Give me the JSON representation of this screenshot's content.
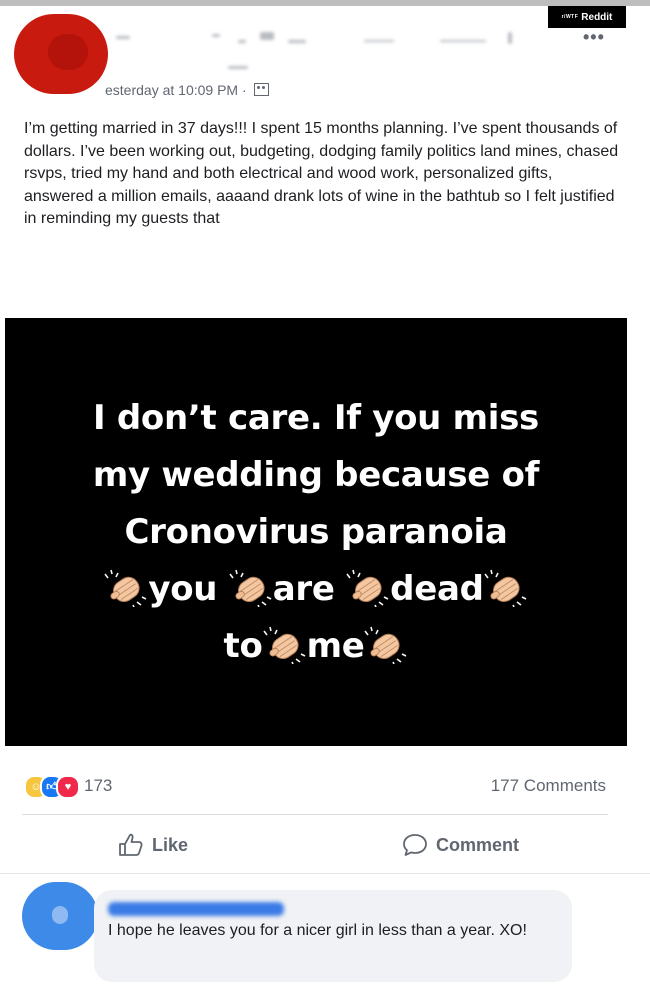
{
  "watermark": {
    "small": "r/WTF",
    "label": "Reddit"
  },
  "post": {
    "timestamp": "esterday at 10:09 PM ·",
    "audience_icon": "friends-icon",
    "text": "I’m getting married in 37 days!!! I spent 15 months planning. I’ve spent thousands of dollars. I’ve been working out, budgeting, dodging family politics land mines, chased rsvps, tried my hand and both electrical and wood work, personalized gifts, answered a million emails, aaaand drank lots of wine in the bathtub so I felt justified in reminding my guests that",
    "image_quote": {
      "line1": "I don’t care. If you miss",
      "line2": "my wedding because of",
      "line3": "Cronovirus paranoia",
      "line4_w1": "you",
      "line4_w2": "are",
      "line4_w3": "dead",
      "line5_w1": "to",
      "line5_w2": "me"
    }
  },
  "stats": {
    "reaction_count": "173",
    "comments": "177 Comments"
  },
  "actions": {
    "like_label": "Like",
    "comment_label": "Comment"
  },
  "comment": {
    "text": "I hope he leaves you for a nicer girl in less than a year. XO!"
  },
  "colors": {
    "avatar_red": "#c81a0f",
    "comment_avatar_blue": "#3d8ae8",
    "text": "#1c1e21",
    "secondary": "#606770",
    "image_background": "#000000"
  }
}
